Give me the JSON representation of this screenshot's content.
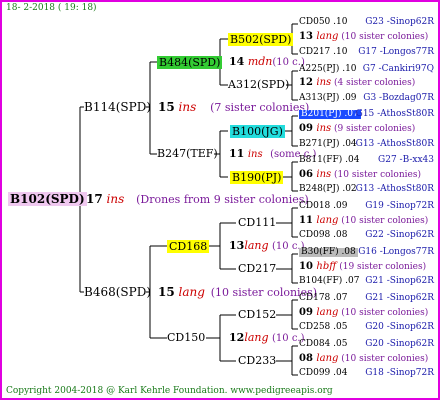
{
  "header": {
    "date": "18-  2-2018 ( 19: 18)"
  },
  "footer": {
    "copyright": "Copyright 2004-2018 @ Karl Kehrle Foundation.   www.pedigreeapis.org"
  },
  "colors": {
    "frame": "#e000e0",
    "root_bg": "#f0c8f0",
    "yellow": "#ffff00",
    "green": "#33cc33",
    "cyan": "#22dddd",
    "blue_hl": "#1a4aff",
    "grey_hl": "#bbbbbb"
  },
  "root": {
    "name": "B102(SPD)",
    "num": "17",
    "race": "ins",
    "desc": "(Drones from 9 sister colonies)"
  },
  "gen1": [
    {
      "name": "B114(SPD)",
      "num": "15",
      "race": "ins",
      "desc": "(7 sister colonies)"
    },
    {
      "name": "B468(SPD)",
      "num": "15",
      "race": "lang",
      "desc": "(10 sister colonies)"
    }
  ],
  "gen2": [
    {
      "name": "B484(SPD)"
    },
    {
      "name": "B247(TEF)",
      "num": "11",
      "race": "ins",
      "desc": "(some c.)"
    },
    {
      "name": "CD168",
      "num": "13",
      "race": "lang",
      "desc": "(10 c.)"
    },
    {
      "name": "CD150",
      "num": "12",
      "race": "lang",
      "desc": "(10 c.)"
    }
  ],
  "gen3": [
    {
      "name": "B502(SPD)",
      "num": "14",
      "race": "mdn",
      "desc": "(10 c.)"
    },
    {
      "name": "A312(SPD)"
    },
    {
      "name": "B100(JG)",
      "num": "09",
      "race": "ins",
      "desc": ""
    },
    {
      "name": "B190(PJ)",
      "num": "06",
      "race": "ins",
      "desc": ""
    },
    {
      "name": "CD111",
      "num": "11",
      "race": "lang",
      "desc": ""
    },
    {
      "name": "CD217",
      "num": "10",
      "race": "hbff",
      "desc": ""
    },
    {
      "name": "CD152",
      "num": "09",
      "race": "lang",
      "desc": ""
    },
    {
      "name": "CD233",
      "num": "08",
      "race": "lang",
      "desc": ""
    }
  ],
  "gen4": [
    {
      "id": "CD050 .10",
      "breeder": "G23 -Sinop62R"
    },
    {
      "num": "13",
      "race": "lang",
      "desc": "(10 sister colonies)"
    },
    {
      "id": "CD217 .10",
      "breeder": "G17 -Longos77R"
    },
    {
      "id": "A225(PJ) .10",
      "breeder": "G7 -Cankiri97Q"
    },
    {
      "num": "12",
      "race": "ins",
      "desc": "(4 sister colonies)"
    },
    {
      "id": "A313(PJ) .09",
      "breeder": "G3 -Bozdag07R"
    },
    {
      "id": "B201(PJ) .07",
      "breeder": "G15 -AthosSt80R"
    },
    {
      "num": "09",
      "race": "ins",
      "desc": "(9 sister colonies)"
    },
    {
      "id": "B271(PJ) .04",
      "breeder": "G13 -AthosSt80R"
    },
    {
      "id": "B811(FF) .04",
      "breeder": "G27 -B-xx43"
    },
    {
      "num": "06",
      "race": "ins",
      "desc": "(10 sister colonies)"
    },
    {
      "id": "B248(PJ) .02",
      "breeder": "G13 -AthosSt80R"
    },
    {
      "id": "CD018 .09",
      "breeder": "G19 -Sinop72R"
    },
    {
      "num": "11",
      "race": "lang",
      "desc": "(10 sister colonies)"
    },
    {
      "id": "CD098 .08",
      "breeder": "G22 -Sinop62R"
    },
    {
      "id": "B30(FF) .08",
      "breeder": "G16 -Longos77R"
    },
    {
      "num": "10",
      "race": "hbff",
      "desc": "(19 sister colonies)"
    },
    {
      "id": "B104(FF) .07",
      "breeder": "G21 -Sinop62R"
    },
    {
      "id": "CD178 .07",
      "breeder": "G21 -Sinop62R"
    },
    {
      "num": "09",
      "race": "lang",
      "desc": "(10 sister colonies)"
    },
    {
      "id": "CD258 .05",
      "breeder": "G20 -Sinop62R"
    },
    {
      "id": "CD084 .05",
      "breeder": "G20 -Sinop62R"
    },
    {
      "num": "08",
      "race": "lang",
      "desc": "(10 sister colonies)"
    },
    {
      "id": "CD099 .04",
      "breeder": "G18 -Sinop72R"
    }
  ]
}
